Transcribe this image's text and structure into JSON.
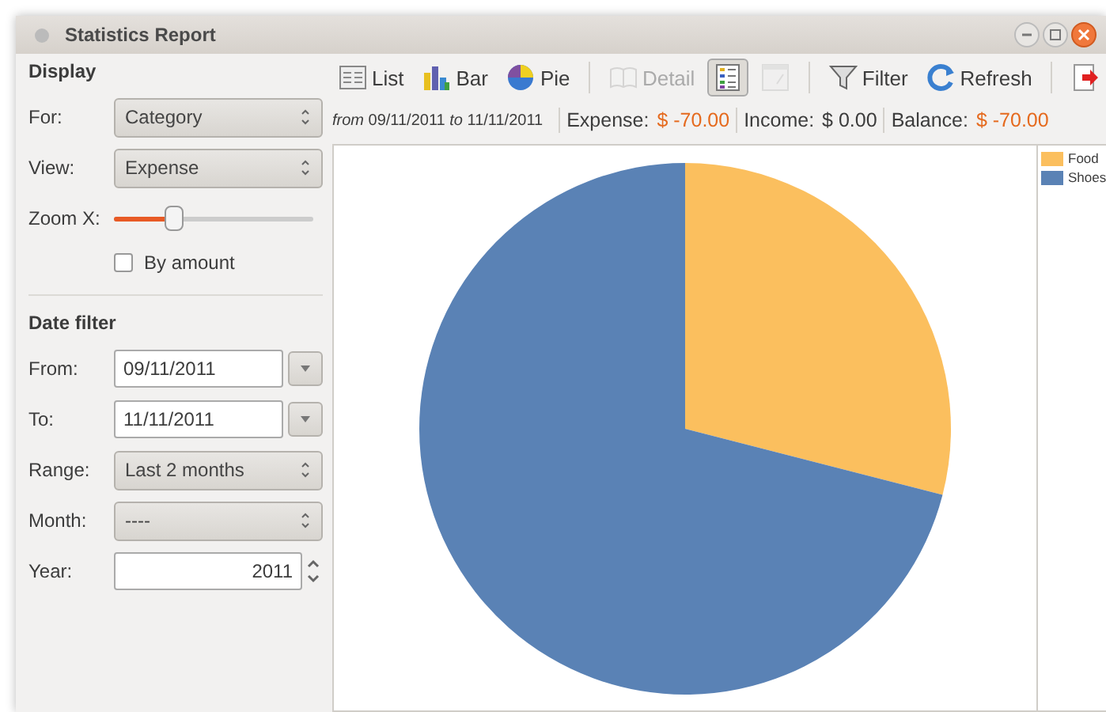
{
  "window": {
    "title": "Statistics Report"
  },
  "sidebar": {
    "display_heading": "Display",
    "fields": [
      {
        "kind": "combo",
        "label": "For:",
        "value": "Category"
      },
      {
        "kind": "combo",
        "label": "View:",
        "value": "Expense"
      },
      {
        "kind": "slider",
        "label": "Zoom X:",
        "level": 0.3
      },
      {
        "kind": "checkbox",
        "label": "By amount",
        "checked": false
      }
    ],
    "date_heading": "Date filter",
    "date_fields": [
      {
        "kind": "date",
        "label": "From:",
        "value": "09/11/2011"
      },
      {
        "kind": "date",
        "label": "To:",
        "value": "11/11/2011"
      },
      {
        "kind": "combo",
        "label": "Range:",
        "value": "Last 2 months"
      },
      {
        "kind": "combo",
        "label": "Month:",
        "value": "----"
      },
      {
        "kind": "spin",
        "label": "Year:",
        "value": "2011"
      }
    ]
  },
  "toolbar": [
    {
      "kind": "list",
      "label": "List",
      "disabled": false,
      "selected": false
    },
    {
      "kind": "bar",
      "label": "Bar",
      "disabled": false,
      "selected": false
    },
    {
      "kind": "pie",
      "label": "Pie",
      "disabled": false,
      "selected": false
    },
    {
      "kind": "sep"
    },
    {
      "kind": "detail",
      "label": "Detail",
      "disabled": true,
      "selected": false
    },
    {
      "kind": "legend",
      "disabled": false,
      "selected": true
    },
    {
      "kind": "percent",
      "disabled": true,
      "selected": false
    },
    {
      "kind": "sep"
    },
    {
      "kind": "filter",
      "label": "Filter",
      "disabled": false,
      "selected": false
    },
    {
      "kind": "refresh",
      "label": "Refresh",
      "disabled": false,
      "selected": false
    },
    {
      "kind": "sep"
    },
    {
      "kind": "export",
      "disabled": false,
      "selected": false
    }
  ],
  "summary": {
    "from_word": "from",
    "from": "09/11/2011",
    "to_word": "to",
    "to": "11/11/2011",
    "items": [
      {
        "label": "Expense:",
        "value": "$ -70.00",
        "negative": true
      },
      {
        "label": "Income:",
        "value": "$ 0.00",
        "negative": false
      },
      {
        "label": "Balance:",
        "value": "$ -70.00",
        "negative": true
      }
    ]
  },
  "chart_data": {
    "type": "pie",
    "categories": [
      "Food",
      "Shoes"
    ],
    "values": [
      29,
      71
    ],
    "colors": [
      "#fbbf5e",
      "#5a82b5"
    ]
  }
}
